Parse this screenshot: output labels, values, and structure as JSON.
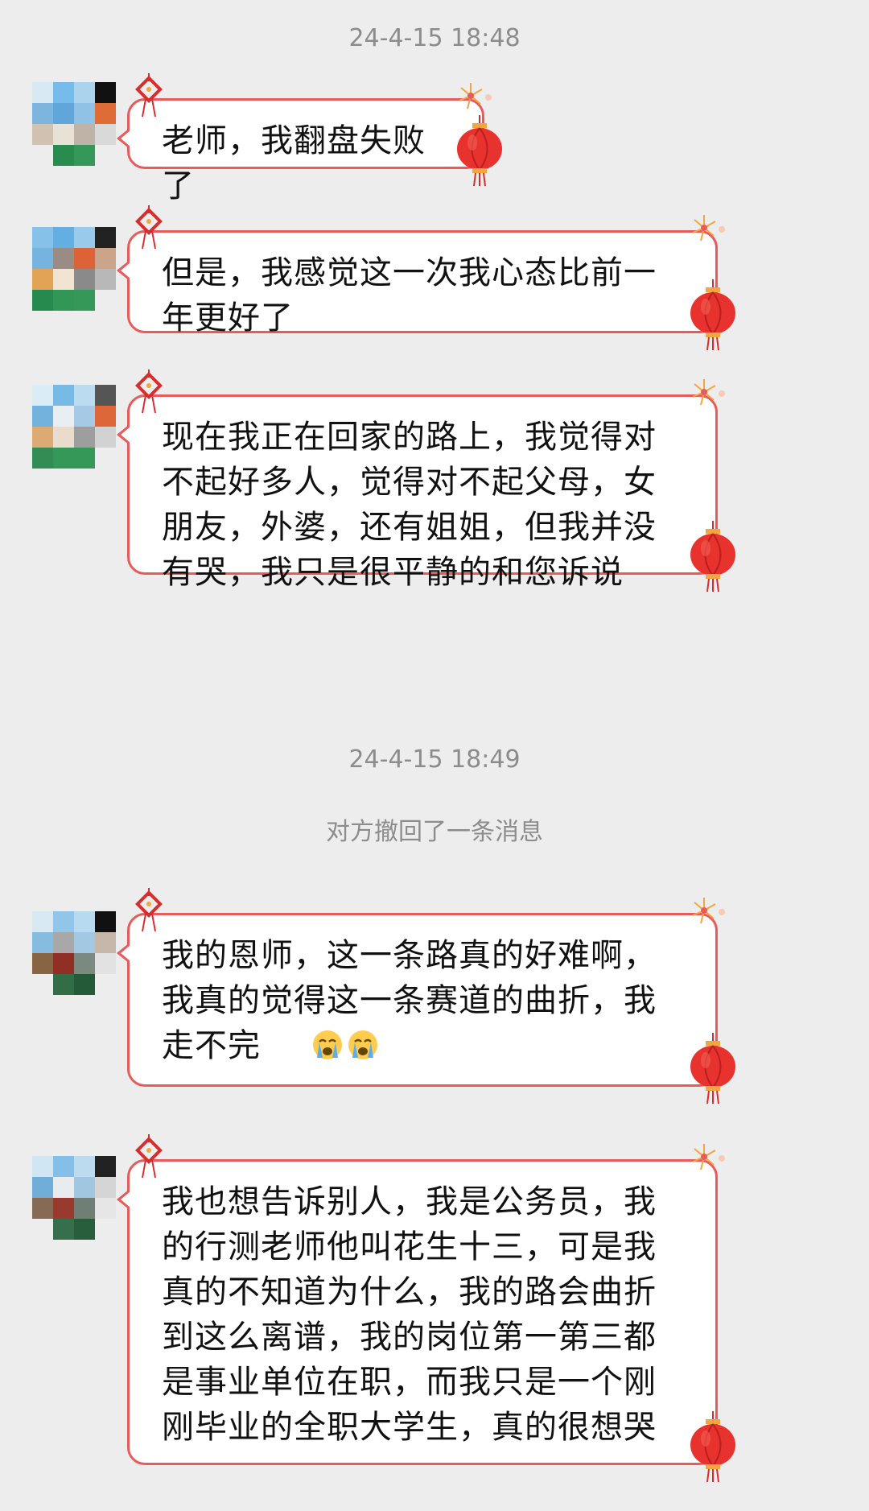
{
  "timestamps": [
    "24-4-15 18:48",
    "24-4-15 18:49"
  ],
  "recall_notice": "对方撤回了一条消息",
  "messages": [
    {
      "text": "老师，我翻盘失败了"
    },
    {
      "text": "但是，我感觉这一次我心态比前一\n年更好了"
    },
    {
      "text": "现在我正在回家的路上，我觉得对\n不起好多人，觉得对不起父母，女\n朋友，外婆，还有姐姐，但我并没\n有哭，我只是很平静的和您诉说"
    },
    {
      "text": "我的恩师，这一条路真的好难啊，\n我真的觉得这一条赛道的曲折，我\n走不完"
    },
    {
      "text": "我也想告诉别人，我是公务员，我\n的行测老师他叫花生十三，可是我\n真的不知道为什么，我的路会曲折\n到这么离谱，我的岗位第一第三都\n是事业单位在职，而我只是一个刚\n刚毕业的全职大学生，真的很想哭"
    }
  ],
  "emoji": [
    "loudly-crying-face",
    "loudly-crying-face"
  ],
  "colors": {
    "background": "#ededed",
    "bubble_border": "#e85b5b",
    "lantern_red": "#e8322d",
    "gold": "#f1a640",
    "meta_text": "#8c8c8c"
  },
  "icons": [
    "avatar-pixelated",
    "chinese-knot-icon",
    "firework-flower-icon",
    "red-lantern-icon",
    "loudly-crying-face-icon"
  ]
}
